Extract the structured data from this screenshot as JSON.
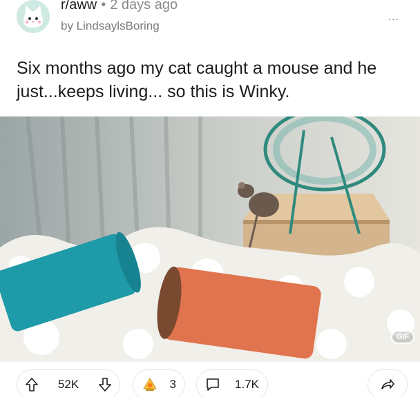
{
  "post": {
    "subreddit": "r/aww",
    "separator": "•",
    "time_ago": "2 days ago",
    "author_line": "by LindsaylsBoring",
    "more_label": "...",
    "title": "Six months ago my cat caught a mouse and he just...keeps living... so this is Winky.",
    "media_badge": "GIF"
  },
  "actions": {
    "upvote_icon": "arrow-up-icon",
    "vote_count": "52K",
    "downvote_icon": "arrow-down-icon",
    "award_icon": "award-icon",
    "award_count": "3",
    "comment_icon": "comment-bubble-icon",
    "comment_count": "1.7K",
    "share_icon": "share-arrow-icon"
  },
  "colors": {
    "teal_tube": "#1f9aa8",
    "orange_tube": "#e0744e",
    "meta_gray": "#878a8c"
  }
}
